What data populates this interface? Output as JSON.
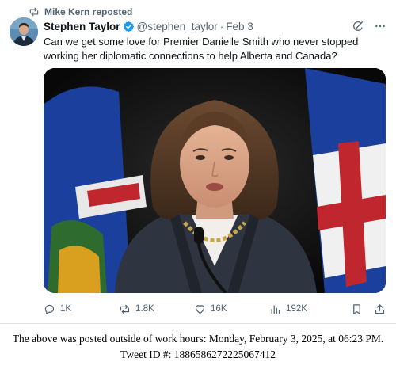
{
  "repost": {
    "label": "Mike Kern reposted"
  },
  "author": {
    "name": "Stephen Taylor",
    "handle": "@stephen_taylor",
    "date": "Feb 3"
  },
  "post": {
    "text": "Can we get some love for Premier Danielle Smith who never stopped working her diplomatic connections to help Alberta and Canada?"
  },
  "actions": {
    "replies": "1K",
    "reposts": "1.8K",
    "likes": "16K",
    "views": "192K"
  },
  "footer": {
    "line1": "The above was posted outside of work hours: Monday, February 3, 2025, at 06:23 PM.",
    "line2": "Tweet ID #: 1886586272225067412"
  },
  "colors": {
    "text": "#0f1419",
    "secondary": "#536471",
    "verified": "#1d9bf0"
  },
  "icons": [
    "repost-icon",
    "verified-badge-icon",
    "grok-icon",
    "more-icon",
    "reply-icon",
    "like-icon",
    "views-icon",
    "bookmark-icon",
    "share-icon"
  ]
}
